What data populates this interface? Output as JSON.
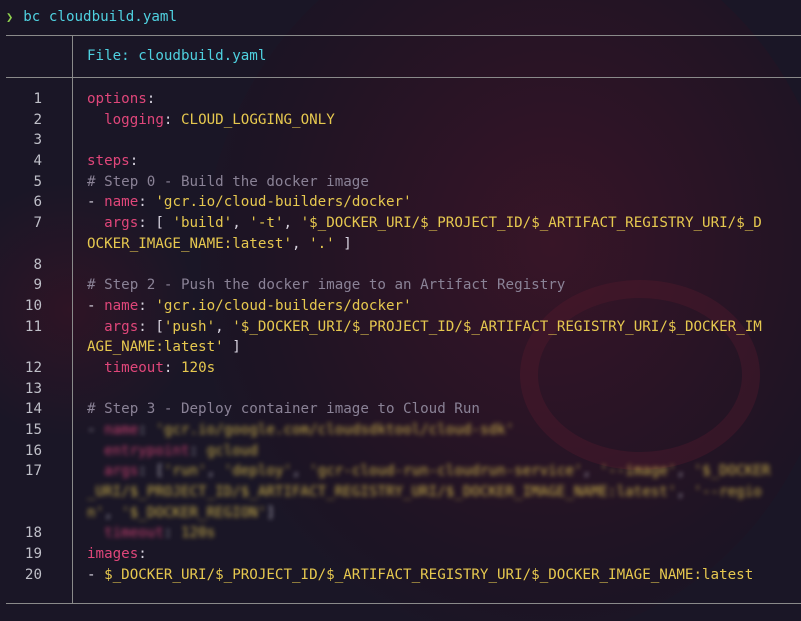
{
  "prompt": {
    "symbol": "❯",
    "command": "bc cloudbuild.yaml"
  },
  "header": {
    "file_label": "File: cloudbuild.yaml"
  },
  "colors": {
    "background": "#1a1626",
    "keyword": "#e0467a",
    "string": "#e6c84f",
    "comment": "#8a8296",
    "accent": "#4fd1e0",
    "prompt_symbol": "#8fd14f"
  },
  "lines": [
    {
      "num": "1",
      "segments": [
        {
          "t": "options",
          "c": "k"
        },
        {
          "t": ":",
          "c": "p"
        }
      ]
    },
    {
      "num": "2",
      "segments": [
        {
          "t": "  ",
          "c": "p"
        },
        {
          "t": "logging",
          "c": "k"
        },
        {
          "t": ": ",
          "c": "p"
        },
        {
          "t": "CLOUD_LOGGING_ONLY",
          "c": "s"
        }
      ]
    },
    {
      "num": "3",
      "segments": []
    },
    {
      "num": "4",
      "segments": [
        {
          "t": "steps",
          "c": "k"
        },
        {
          "t": ":",
          "c": "p"
        }
      ]
    },
    {
      "num": "5",
      "segments": [
        {
          "t": "# Step 0 - Build the docker image",
          "c": "c"
        }
      ]
    },
    {
      "num": "6",
      "segments": [
        {
          "t": "- ",
          "c": "p"
        },
        {
          "t": "name",
          "c": "k"
        },
        {
          "t": ": ",
          "c": "p"
        },
        {
          "t": "'gcr.io/cloud-builders/docker'",
          "c": "s"
        }
      ]
    },
    {
      "num": "7",
      "segments": [
        {
          "t": "  ",
          "c": "p"
        },
        {
          "t": "args",
          "c": "k"
        },
        {
          "t": ": [ ",
          "c": "p"
        },
        {
          "t": "'build'",
          "c": "s"
        },
        {
          "t": ", ",
          "c": "p"
        },
        {
          "t": "'-t'",
          "c": "s"
        },
        {
          "t": ", ",
          "c": "p"
        },
        {
          "t": "'$_DOCKER_URI/$_PROJECT_ID/$_ARTIFACT_REGISTRY_URI/$_D",
          "c": "s"
        }
      ]
    },
    {
      "num": "",
      "segments": [
        {
          "t": "OCKER_IMAGE_NAME:latest'",
          "c": "s"
        },
        {
          "t": ", ",
          "c": "p"
        },
        {
          "t": "'.'",
          "c": "s"
        },
        {
          "t": " ]",
          "c": "p"
        }
      ]
    },
    {
      "num": "8",
      "segments": []
    },
    {
      "num": "9",
      "segments": [
        {
          "t": "# Step 2 - Push the docker image to an Artifact Registry",
          "c": "c"
        }
      ]
    },
    {
      "num": "10",
      "segments": [
        {
          "t": "- ",
          "c": "p"
        },
        {
          "t": "name",
          "c": "k"
        },
        {
          "t": ": ",
          "c": "p"
        },
        {
          "t": "'gcr.io/cloud-builders/docker'",
          "c": "s"
        }
      ]
    },
    {
      "num": "11",
      "segments": [
        {
          "t": "  ",
          "c": "p"
        },
        {
          "t": "args",
          "c": "k"
        },
        {
          "t": ": [",
          "c": "p"
        },
        {
          "t": "'push'",
          "c": "s"
        },
        {
          "t": ", ",
          "c": "p"
        },
        {
          "t": "'$_DOCKER_URI/$_PROJECT_ID/$_ARTIFACT_REGISTRY_URI/$_DOCKER_IM",
          "c": "s"
        }
      ]
    },
    {
      "num": "",
      "segments": [
        {
          "t": "AGE_NAME:latest'",
          "c": "s"
        },
        {
          "t": " ]",
          "c": "p"
        }
      ]
    },
    {
      "num": "12",
      "segments": [
        {
          "t": "  ",
          "c": "p"
        },
        {
          "t": "timeout",
          "c": "k"
        },
        {
          "t": ": ",
          "c": "p"
        },
        {
          "t": "120s",
          "c": "s"
        }
      ]
    },
    {
      "num": "13",
      "segments": []
    },
    {
      "num": "14",
      "segments": [
        {
          "t": "# Step 3 - Deploy container image to Cloud Run",
          "c": "c"
        }
      ]
    },
    {
      "num": "15",
      "blurred": true,
      "segments": [
        {
          "t": "- ",
          "c": "p"
        },
        {
          "t": "name",
          "c": "k"
        },
        {
          "t": ": ",
          "c": "p"
        },
        {
          "t": "'gcr.io/google.com/cloudsdktool/cloud-sdk'",
          "c": "s"
        }
      ]
    },
    {
      "num": "16",
      "blurred": true,
      "segments": [
        {
          "t": "  ",
          "c": "p"
        },
        {
          "t": "entrypoint",
          "c": "k"
        },
        {
          "t": ": ",
          "c": "p"
        },
        {
          "t": "gcloud",
          "c": "s"
        }
      ]
    },
    {
      "num": "17",
      "blurred": true,
      "segments": [
        {
          "t": "  ",
          "c": "p"
        },
        {
          "t": "args",
          "c": "k"
        },
        {
          "t": ": [",
          "c": "p"
        },
        {
          "t": "'run'",
          "c": "s"
        },
        {
          "t": ", ",
          "c": "p"
        },
        {
          "t": "'deploy'",
          "c": "s"
        },
        {
          "t": ", ",
          "c": "p"
        },
        {
          "t": "'gcr-cloud-run-cloudrun-service'",
          "c": "s"
        },
        {
          "t": ", ",
          "c": "p"
        },
        {
          "t": "'--image'",
          "c": "s"
        },
        {
          "t": ", ",
          "c": "p"
        },
        {
          "t": "'$_DOCKER",
          "c": "s"
        }
      ]
    },
    {
      "num": "",
      "blurred": true,
      "segments": [
        {
          "t": "_URI/$_PROJECT_ID/$_ARTIFACT_REGISTRY_URI/$_DOCKER_IMAGE_NAME:latest'",
          "c": "s"
        },
        {
          "t": ", ",
          "c": "p"
        },
        {
          "t": "'--regio",
          "c": "s"
        }
      ]
    },
    {
      "num": "",
      "blurred": true,
      "segments": [
        {
          "t": "n'",
          "c": "s"
        },
        {
          "t": ", ",
          "c": "p"
        },
        {
          "t": "'$_DOCKER_REGION'",
          "c": "s"
        },
        {
          "t": "]",
          "c": "p"
        }
      ]
    },
    {
      "num": "18",
      "blurred": true,
      "segments": [
        {
          "t": "  ",
          "c": "p"
        },
        {
          "t": "timeout",
          "c": "k"
        },
        {
          "t": ": ",
          "c": "p"
        },
        {
          "t": "120s",
          "c": "s"
        }
      ]
    },
    {
      "num": "19",
      "segments": [
        {
          "t": "images",
          "c": "k"
        },
        {
          "t": ":",
          "c": "p"
        }
      ]
    },
    {
      "num": "20",
      "segments": [
        {
          "t": "- ",
          "c": "p"
        },
        {
          "t": "$_DOCKER_URI/$_PROJECT_ID/$_ARTIFACT_REGISTRY_URI/$_DOCKER_IMAGE_NAME:latest",
          "c": "s"
        }
      ]
    }
  ]
}
